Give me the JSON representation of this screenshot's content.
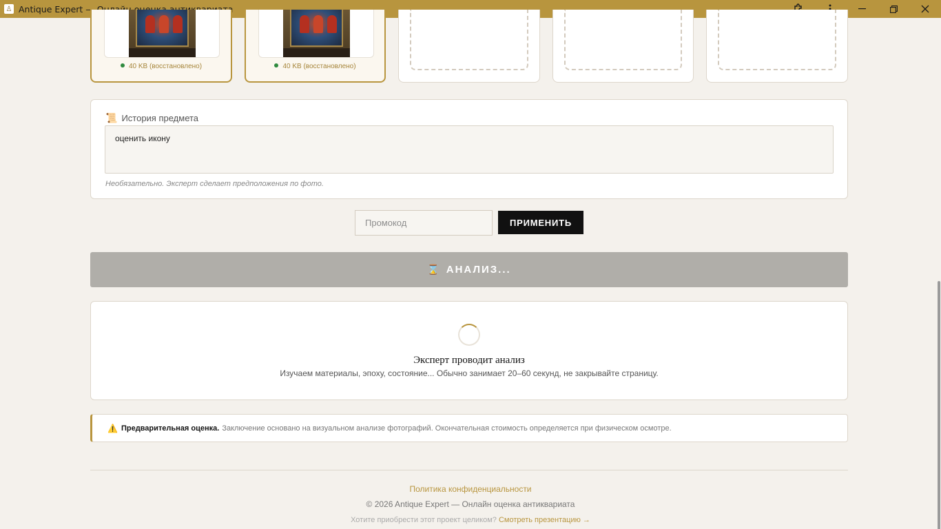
{
  "window": {
    "title": "Antique Expert — Онлайн оценка антиквариата",
    "colors": {
      "titlebar": "#b8953e",
      "accent": "#b8953e",
      "ok": "#2e8a3e"
    }
  },
  "photos": [
    {
      "status": "40 KB (восстановлено)"
    },
    {
      "status": "40 KB (восстановлено)"
    }
  ],
  "history": {
    "label": "История предмета",
    "value": "оценить икону",
    "hint": "Необязательно. Эксперт сделает предположения по фото."
  },
  "promo": {
    "placeholder": "Промокод",
    "apply_label": "ПРИМЕНИТЬ"
  },
  "analyze": {
    "label": "АНАЛИЗ...",
    "icon": "hourglass-icon"
  },
  "progress": {
    "title": "Эксперт проводит анализ",
    "subtitle": "Изучаем материалы, эпоху, состояние... Обычно занимает 20–60 секунд, не закрывайте страницу."
  },
  "disclaimer": {
    "bold": "Предварительная оценка.",
    "text": "Заключение основано на визуальном анализе фотографий. Окончательная стоимость определяется при физическом осмотре."
  },
  "footer": {
    "privacy": "Политика конфиденциальности",
    "copyright": "© 2026 Antique Expert — Онлайн оценка антиквариата",
    "buy_prefix": "Хотите приобрести этот проект целиком?",
    "buy_link": "Смотреть презентацию →"
  }
}
